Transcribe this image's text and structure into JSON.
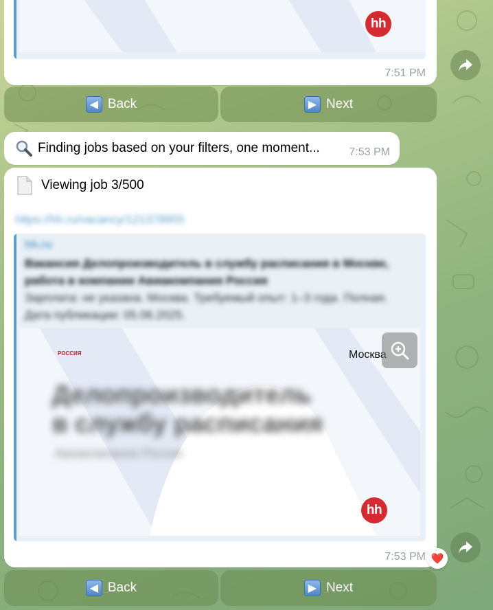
{
  "messages": {
    "prev": {
      "time": "7:51 PM"
    },
    "finding": {
      "icon": "magnifier-icon",
      "text": "Finding jobs based on your filters, one moment...",
      "time": "7:53 PM"
    },
    "job": {
      "icon": "page-icon",
      "heading": "Viewing job 3/500",
      "link": "https://hh.ru/vacancy/121378955",
      "preview": {
        "site": "hh.ru",
        "title": "Вакансия Делопроизводитель в службу расписания в Москве, работа в компании Авиакомпания Россия",
        "description": "Зарплата: не указана. Москва. Требуемый опыт: 1–3 года. Полная. Дата публикации: 05.06.2025.",
        "image_city": "Москва",
        "image_company_logo": "РОССИЯ",
        "image_job_title": "Делопроизводитель в службу расписания",
        "image_company": "Авиакомпания Россия",
        "hh_logo": "hh"
      },
      "time": "7:53 PM",
      "reaction": "❤️"
    }
  },
  "keyboard_top": {
    "back": "Back",
    "next": "Next"
  },
  "keyboard_bottom": {
    "back": "Back",
    "next": "Next"
  },
  "prev_hh_logo": "hh",
  "colors": {
    "bubble": "#ffffff",
    "link": "#5a9fca",
    "hh_red": "#d52b30",
    "button_bg": "#7d9b5e"
  }
}
